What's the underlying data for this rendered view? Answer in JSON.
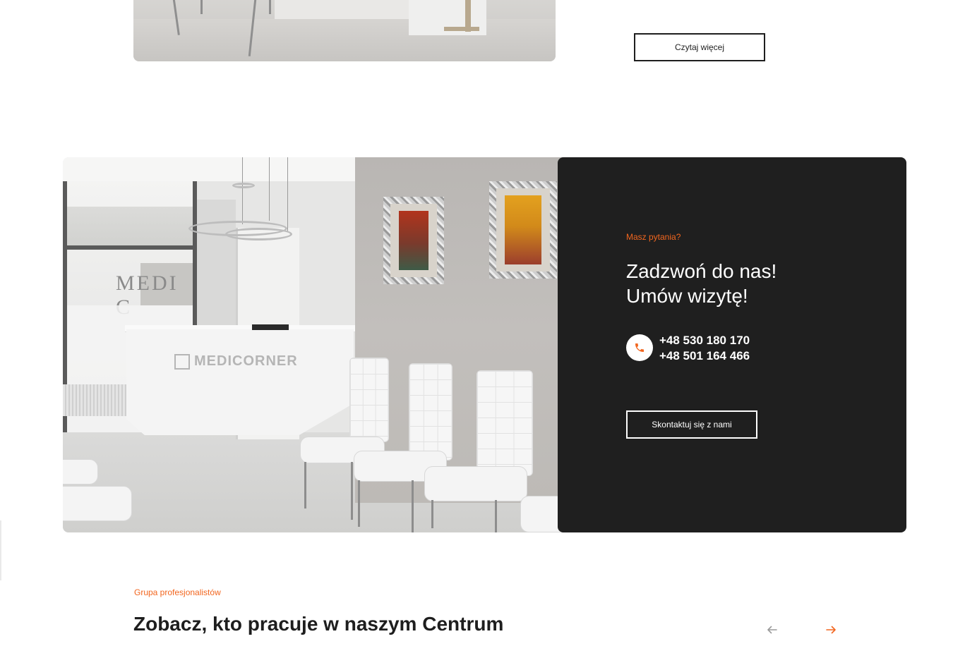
{
  "read_more": {
    "label": "Czytaj więcej"
  },
  "contact_card": {
    "eyebrow": "Masz pytania?",
    "heading_line1": "Zadzwoń do nas!",
    "heading_line2": "Umów wizytę!",
    "phone_1": "+48 530 180 170",
    "phone_2": "+48 501 164 466",
    "button_label": "Skontaktuj się z nami",
    "icon": "phone-icon"
  },
  "reception_photo": {
    "desk_logo_text": "MEDICORNER",
    "window_text": "MEDI C"
  },
  "team_section": {
    "eyebrow": "Grupa profesjonalistów",
    "title": "Zobacz, kto pracuje w naszym Centrum",
    "prev_icon": "arrow-left-icon",
    "next_icon": "arrow-right-icon"
  },
  "colors": {
    "accent": "#f2661f",
    "dark_card": "#1f1f1f",
    "text": "#1e1e1e"
  }
}
